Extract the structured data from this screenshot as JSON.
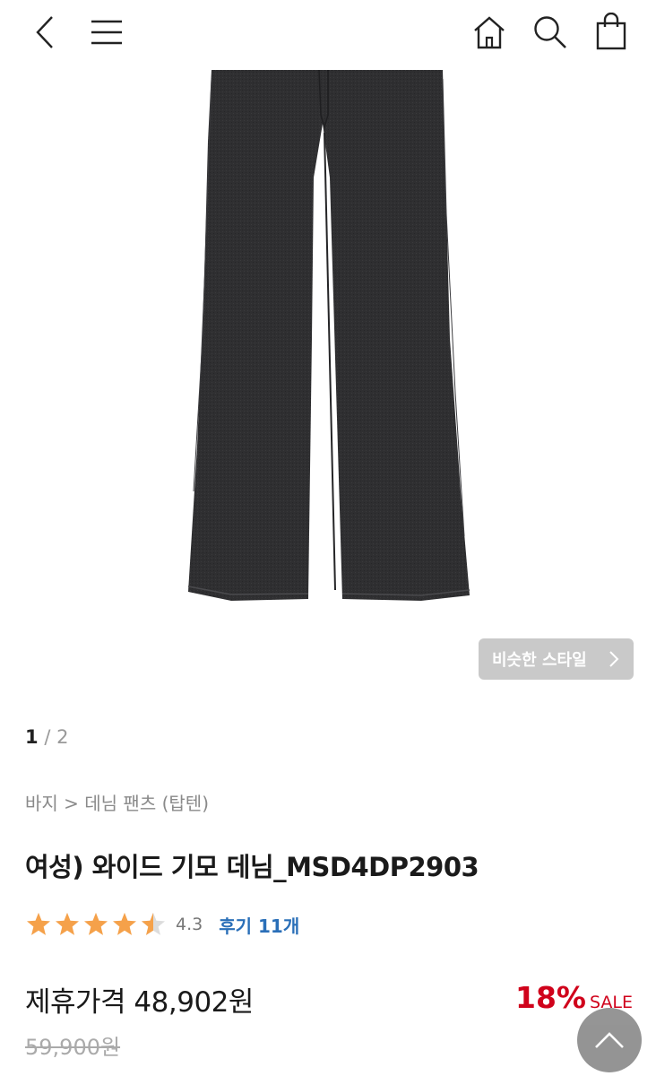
{
  "header": {
    "icons": [
      "back-icon",
      "menu-icon",
      "home-icon",
      "search-icon",
      "shopping-bag-icon"
    ]
  },
  "product": {
    "image": {
      "pager_current": "1",
      "pager_total": "/ 2"
    },
    "similar_style_label": "비슷한 스타일",
    "breadcrumb": "바지 > 데님 팬츠 (탑텐)",
    "title": "여성) 와이드 기모 데님_MSD4DP2903",
    "rating": {
      "score": 4.3,
      "score_text": "4.3",
      "review_label": "후기 11개"
    },
    "price": {
      "label": "제휴가격 48,902원",
      "original": "59,900원",
      "discount_pct": "18%",
      "discount_tag": "SALE"
    }
  },
  "colors": {
    "sale_red": "#d0021b",
    "review_blue": "#2a6fb8",
    "star": "#f5a14a",
    "jeans": "#2e2e30"
  }
}
